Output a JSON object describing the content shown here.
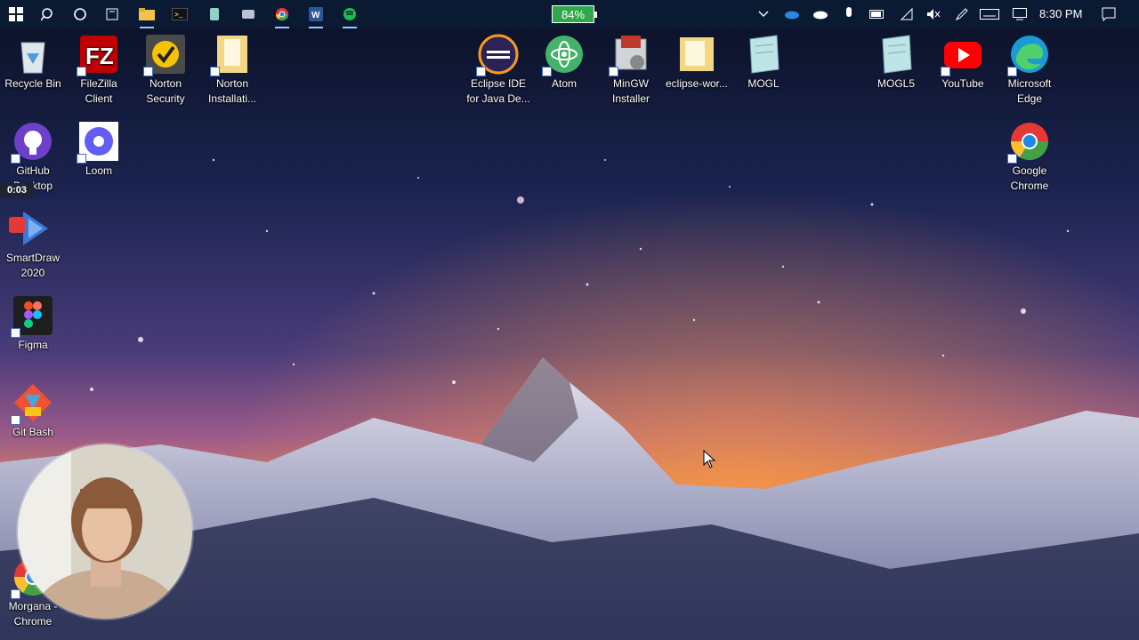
{
  "taskbar": {
    "icons": [
      "windows-start-icon",
      "search-icon",
      "cortana-icon",
      "task-view-icon",
      "file-explorer-icon",
      "terminal-icon",
      "app-icon",
      "app-icon",
      "chrome-icon",
      "word-icon",
      "spotify-icon"
    ],
    "battery": "84%",
    "tray_icons": [
      "chevron-up-icon",
      "onedrive-icon",
      "cloud-icon",
      "microphone-icon",
      "battery-icon",
      "wifi-icon",
      "volume-muted-icon",
      "pen-icon",
      "keyboard-icon",
      "display-icon"
    ],
    "clock": "8:30 PM",
    "notification_icon": "notification-icon"
  },
  "desktop": {
    "icons": [
      {
        "label": "Recycle Bin"
      },
      {
        "label": "FileZilla Client"
      },
      {
        "label": "Norton\nSecurity"
      },
      {
        "label": "Norton\nInstallati..."
      },
      {
        "label": "Eclipse IDE\nfor Java De..."
      },
      {
        "label": "Atom"
      },
      {
        "label": "MinGW\nInstaller"
      },
      {
        "label": "eclipse-wor..."
      },
      {
        "label": "MOGL"
      },
      {
        "label": "MOGL5"
      },
      {
        "label": "YouTube"
      },
      {
        "label": "Microsoft\nEdge"
      },
      {
        "label": "GitHub\nDesktop"
      },
      {
        "label": "Loom"
      },
      {
        "label": "Google\nChrome"
      },
      {
        "label": "SmartDraw\n2020"
      },
      {
        "label": "Figma"
      },
      {
        "label": "Git Bash"
      },
      {
        "label": "Morgana -\nChrome"
      }
    ]
  },
  "recorder": {
    "elapsed": "0:03"
  }
}
